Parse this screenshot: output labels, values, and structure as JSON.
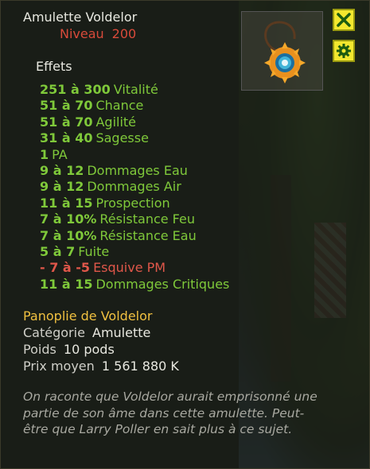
{
  "item": {
    "name": "Amulette Voldelor",
    "level_label": "Niveau",
    "level_value": "200"
  },
  "effects_header": "Effets",
  "effects": [
    {
      "value": "251 à 300",
      "stat": "Vitalité",
      "positive": true
    },
    {
      "value": "51 à 70",
      "stat": "Chance",
      "positive": true
    },
    {
      "value": "51 à 70",
      "stat": "Agilité",
      "positive": true
    },
    {
      "value": "31 à 40",
      "stat": "Sagesse",
      "positive": true
    },
    {
      "value": "1",
      "stat": "PA",
      "positive": true
    },
    {
      "value": "9 à 12",
      "stat": "Dommages Eau",
      "positive": true
    },
    {
      "value": "9 à 12",
      "stat": "Dommages Air",
      "positive": true
    },
    {
      "value": "11 à 15",
      "stat": "Prospection",
      "positive": true
    },
    {
      "value": "7 à 10%",
      "stat": "Résistance Feu",
      "positive": true
    },
    {
      "value": "7 à 10%",
      "stat": "Résistance Eau",
      "positive": true
    },
    {
      "value": "5 à 7",
      "stat": "Fuite",
      "positive": true
    },
    {
      "value": "- 7 à -5",
      "stat": "Esquive PM",
      "positive": false
    },
    {
      "value": "11 à 15",
      "stat": "Dommages Critiques",
      "positive": true
    }
  ],
  "set_name": "Panoplie de Voldelor",
  "details": {
    "category_label": "Catégorie",
    "category_value": "Amulette",
    "weight_label": "Poids",
    "weight_value": "10 pods",
    "price_label": "Prix moyen",
    "price_value": "1 561 880 K"
  },
  "description": "On raconte que Voldelor aurait emprisonné une partie de son âme dans cette amulette. Peut-être que Larry Poller en sait plus à ce sujet.",
  "buttons": {
    "close_icon": "close-icon",
    "settings_icon": "gear-icon"
  },
  "colors": {
    "positive": "#7fc93a",
    "negative": "#e0574a",
    "set_name": "#f0c040",
    "level": "#d84a3a",
    "button": "#f3e82e"
  }
}
